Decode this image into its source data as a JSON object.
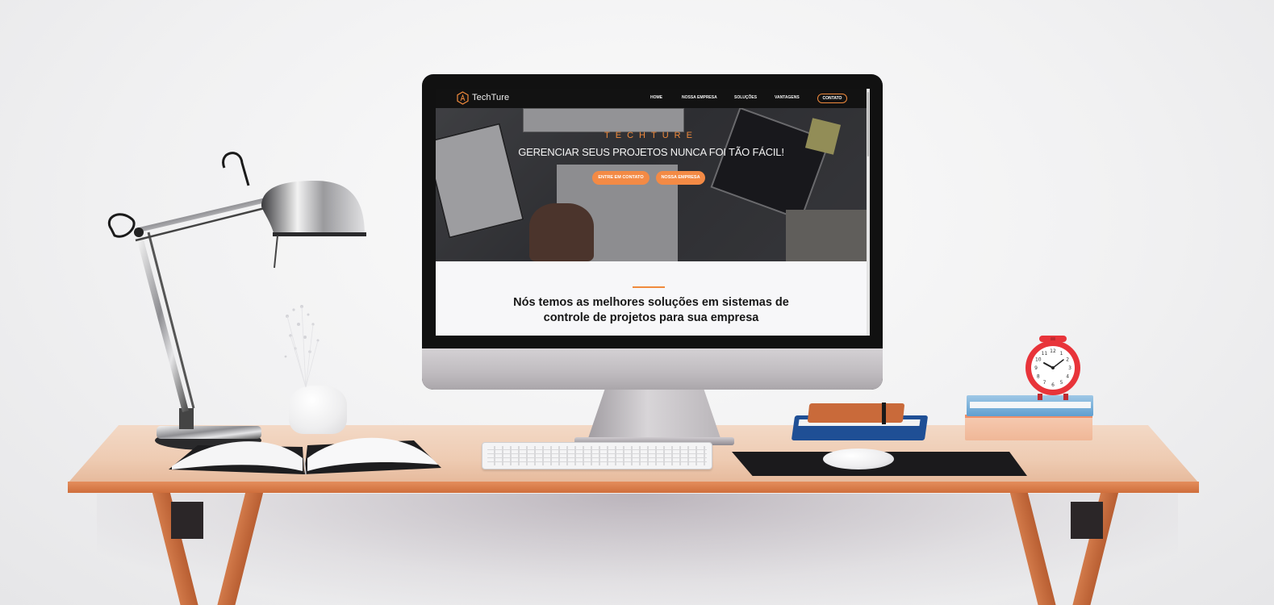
{
  "website": {
    "brand": "TechTure",
    "nav": {
      "items": [
        "HOME",
        "NOSSA EMPRESA",
        "SOLUÇÕES",
        "VANTAGENS"
      ],
      "contact": "CONTATO"
    },
    "hero": {
      "kicker": "TECHTURE",
      "headline": "GERENCIAR SEUS PROJETOS NUNCA FOI TÃO FÁCIL!",
      "buttons": [
        "ENTRE EM CONTATO",
        "NOSSA EMPRESA"
      ]
    },
    "section": {
      "title_line1": "Nós temos as melhores soluções em sistemas de",
      "title_line2": "controle de projetos para sua empresa"
    }
  },
  "colors": {
    "accent": "#f08a3c",
    "nav_bg": "#121212",
    "desk_wood": "#e48d5c"
  },
  "clock": {
    "numerals": [
      "12",
      "1",
      "2",
      "3",
      "4",
      "5",
      "6",
      "7",
      "8",
      "9",
      "10",
      "11"
    ]
  }
}
